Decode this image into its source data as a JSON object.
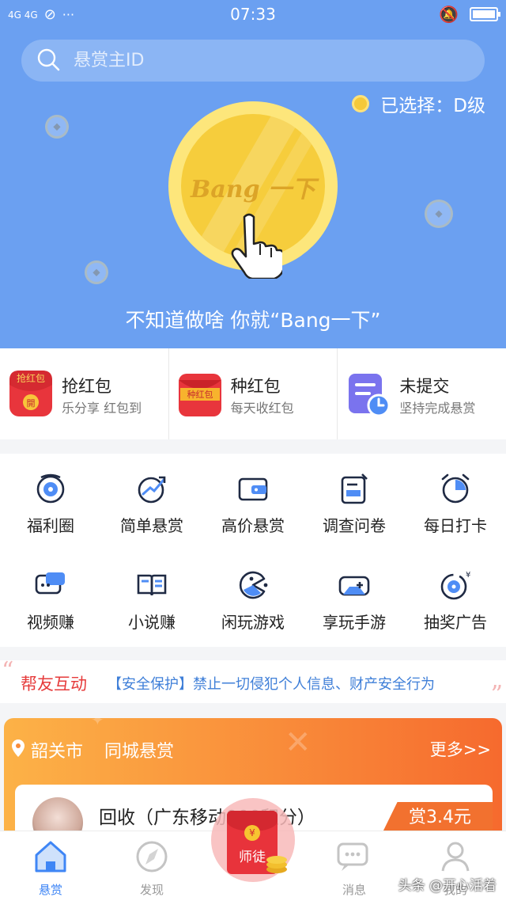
{
  "status_bar": {
    "network": "4G 4G",
    "time": "07:33",
    "more": "···"
  },
  "search": {
    "placeholder": "悬赏主ID"
  },
  "hero": {
    "selected_grade": "已选择：D级",
    "coin_text": "Bang 一下",
    "slogan": "不知道做啥 你就“Bang一下”"
  },
  "quick_actions": [
    {
      "title": "抢红包",
      "subtitle": "乐分享 红包到",
      "icon": "red-envelope-grab-icon",
      "icon_text": "抢红包",
      "icon_seal": "開"
    },
    {
      "title": "种红包",
      "subtitle": "每天收红包",
      "icon": "red-envelope-plant-icon",
      "icon_text": "种红包"
    },
    {
      "title": "未提交",
      "subtitle": "坚持完成悬赏",
      "icon": "pending-document-icon"
    }
  ],
  "grid": [
    {
      "label": "福利圈",
      "icon": "welfare-circle-icon"
    },
    {
      "label": "简单悬赏",
      "icon": "simple-bounty-icon"
    },
    {
      "label": "高价悬赏",
      "icon": "wallet-icon"
    },
    {
      "label": "调查问卷",
      "icon": "survey-icon"
    },
    {
      "label": "每日打卡",
      "icon": "alarm-clock-icon"
    },
    {
      "label": "视频赚",
      "icon": "video-chat-icon"
    },
    {
      "label": "小说赚",
      "icon": "book-icon"
    },
    {
      "label": "闲玩游戏",
      "icon": "pacman-icon"
    },
    {
      "label": "享玩手游",
      "icon": "gamepad-icon"
    },
    {
      "label": "抽奖广告",
      "icon": "lottery-dial-icon"
    }
  ],
  "notice": {
    "brand": "帮友互动",
    "message": "【安全保护】禁止一切侵犯个人信息、财产安全行为"
  },
  "local_bounty": {
    "city": "韶关市",
    "title": "同城悬赏",
    "more": "更多>>",
    "task": {
      "title": "回收（广东移动900积分）",
      "reward": "赏3.4元"
    }
  },
  "tabbar": [
    {
      "label": "悬赏",
      "icon": "home-icon",
      "active": true
    },
    {
      "label": "发现",
      "icon": "compass-icon",
      "active": false
    },
    {
      "label": "师徒",
      "icon": "mentor-envelope-icon",
      "active": false
    },
    {
      "label": "消息",
      "icon": "message-icon",
      "active": false
    },
    {
      "label": "我的",
      "icon": "profile-icon",
      "active": false
    }
  ],
  "master_seal": "¥",
  "watermark": "头条 @开心活着",
  "colors": {
    "hero_bg": "#6ba0f1",
    "accent_blue": "#3f86f5",
    "accent_red": "#e63b3b",
    "accent_orange": "#f98c3a"
  }
}
